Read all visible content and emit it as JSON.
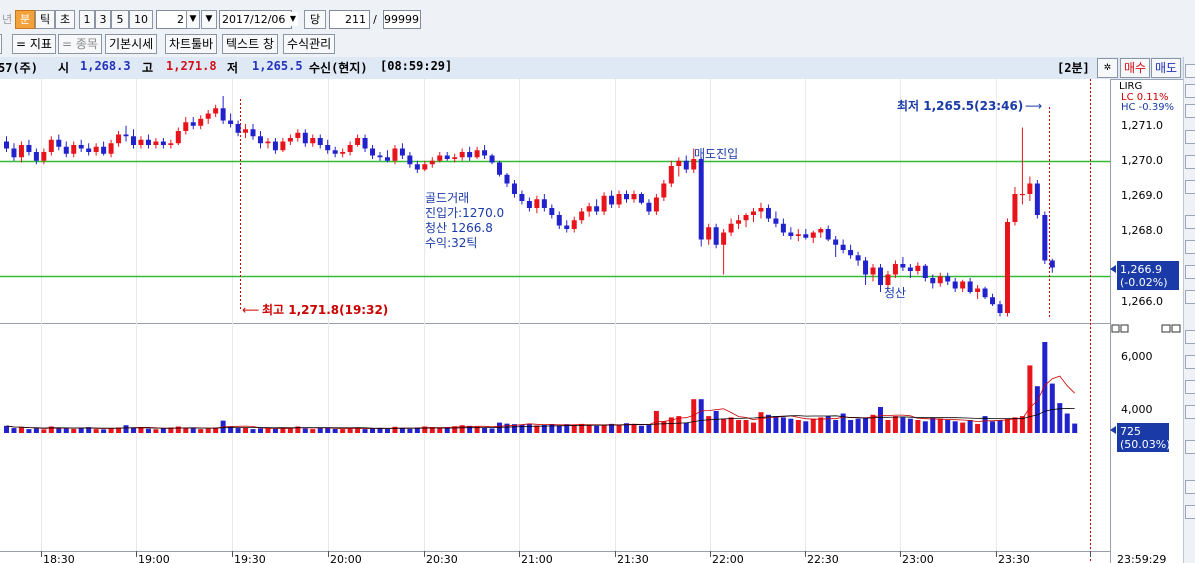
{
  "toolbar": {
    "period_tabs": [
      "년",
      "분",
      "틱",
      "초"
    ],
    "interval_buttons": [
      "1",
      "3",
      "5",
      "10"
    ],
    "interval_value": "2",
    "date_value": "2017/12/06",
    "dang_label": "당",
    "count_value": "211",
    "slash": "/",
    "max_value": "99999"
  },
  "toolbar2": {
    "buttons": [
      "= 지표",
      "= 종목",
      "기본시세",
      "차트툴바",
      "텍스트 창",
      "수식관리"
    ]
  },
  "info": {
    "code": "57(주)",
    "open_label": "시",
    "open_value": "1,268.3",
    "high_label": "고",
    "high_value": "1,271.8",
    "low_label": "저",
    "low_value": "1,265.5",
    "status": "수신(현지)",
    "time": "[08:59:29]",
    "period_badge": "[2분]",
    "settings_icon": "gear-icon",
    "buy_label": "매수",
    "sell_label": "매도"
  },
  "colors": {
    "up": "#e8141c",
    "down": "#2222cc",
    "hline": "#33bb33",
    "note": "#1a3aa8",
    "red_text": "#cc0000"
  },
  "annotations": {
    "lowest": "최저 1,265.5(23:46)",
    "highest": "최고 1,271.8(19:32)",
    "entry": "매도진입",
    "exit": "청산",
    "trade_lines": [
      "골드거래",
      "진입가:1270.0",
      "청산 1266.8",
      "수익:32틱"
    ]
  },
  "chart_data": {
    "type": "candlestick",
    "price_axis": {
      "ticks": [
        "1,271.0",
        "1,270.0",
        "1,269.0",
        "1,268.0",
        "1,266.0"
      ],
      "range": [
        1265.4,
        1271.8
      ]
    },
    "price_header": [
      "LIRG",
      "LC 0.11%",
      "HC -0.39%"
    ],
    "current_price": "1,266.9",
    "current_change": "(-0.02%)",
    "horizontal_lines": [
      1269.95,
      1266.65
    ],
    "volume_axis": {
      "ticks": [
        "6,000",
        "4,000"
      ],
      "range": [
        0,
        7500
      ]
    },
    "current_volume": "725",
    "current_volume_pct": "(50.03%)",
    "x_ticks": [
      "18:30",
      "19:00",
      "19:30",
      "20:00",
      "20:30",
      "21:00",
      "21:30",
      "22:00",
      "22:30",
      "23:00",
      "23:30",
      "23:59:29"
    ],
    "candles": [
      [
        1270.5,
        1270.65,
        1270.2,
        1270.3
      ],
      [
        1270.3,
        1270.45,
        1269.95,
        1270.05
      ],
      [
        1270.05,
        1270.5,
        1269.9,
        1270.4
      ],
      [
        1270.4,
        1270.55,
        1270.1,
        1270.2
      ],
      [
        1270.2,
        1270.3,
        1269.85,
        1269.95
      ],
      [
        1269.95,
        1270.3,
        1269.85,
        1270.2
      ],
      [
        1270.2,
        1270.65,
        1270.1,
        1270.55
      ],
      [
        1270.55,
        1270.7,
        1270.25,
        1270.35
      ],
      [
        1270.35,
        1270.5,
        1270.05,
        1270.15
      ],
      [
        1270.15,
        1270.5,
        1270.05,
        1270.4
      ],
      [
        1270.4,
        1270.55,
        1270.2,
        1270.3
      ],
      [
        1270.3,
        1270.45,
        1270.1,
        1270.2
      ],
      [
        1270.2,
        1270.45,
        1270.1,
        1270.35
      ],
      [
        1270.35,
        1270.5,
        1270.1,
        1270.15
      ],
      [
        1270.15,
        1270.55,
        1270.05,
        1270.45
      ],
      [
        1270.45,
        1270.8,
        1270.35,
        1270.7
      ],
      [
        1270.7,
        1270.95,
        1270.5,
        1270.65
      ],
      [
        1270.65,
        1270.85,
        1270.3,
        1270.4
      ],
      [
        1270.4,
        1270.65,
        1270.3,
        1270.55
      ],
      [
        1270.55,
        1270.7,
        1270.3,
        1270.4
      ],
      [
        1270.4,
        1270.6,
        1270.3,
        1270.5
      ],
      [
        1270.5,
        1270.6,
        1270.3,
        1270.4
      ],
      [
        1270.4,
        1270.55,
        1270.3,
        1270.45
      ],
      [
        1270.45,
        1270.9,
        1270.4,
        1270.8
      ],
      [
        1270.8,
        1271.2,
        1270.7,
        1271.05
      ],
      [
        1271.05,
        1271.2,
        1270.85,
        1270.95
      ],
      [
        1270.95,
        1271.25,
        1270.85,
        1271.15
      ],
      [
        1271.15,
        1271.4,
        1271.0,
        1271.3
      ],
      [
        1271.3,
        1271.55,
        1271.2,
        1271.45
      ],
      [
        1271.45,
        1271.8,
        1271.0,
        1271.1
      ],
      [
        1271.1,
        1271.3,
        1270.9,
        1271.0
      ],
      [
        1271.0,
        1271.1,
        1270.65,
        1270.75
      ],
      [
        1270.75,
        1271.0,
        1270.6,
        1270.85
      ],
      [
        1270.85,
        1271.0,
        1270.55,
        1270.65
      ],
      [
        1270.65,
        1270.8,
        1270.3,
        1270.45
      ],
      [
        1270.45,
        1270.6,
        1270.3,
        1270.5
      ],
      [
        1270.5,
        1270.6,
        1270.15,
        1270.25
      ],
      [
        1270.25,
        1270.6,
        1270.2,
        1270.5
      ],
      [
        1270.5,
        1270.7,
        1270.4,
        1270.6
      ],
      [
        1270.6,
        1270.85,
        1270.5,
        1270.75
      ],
      [
        1270.75,
        1270.85,
        1270.35,
        1270.45
      ],
      [
        1270.45,
        1270.7,
        1270.35,
        1270.6
      ],
      [
        1270.6,
        1270.7,
        1270.3,
        1270.4
      ],
      [
        1270.4,
        1270.55,
        1270.15,
        1270.25
      ],
      [
        1270.25,
        1270.35,
        1270.05,
        1270.15
      ],
      [
        1270.15,
        1270.3,
        1270.05,
        1270.2
      ],
      [
        1270.2,
        1270.5,
        1270.1,
        1270.4
      ],
      [
        1270.4,
        1270.7,
        1270.35,
        1270.6
      ],
      [
        1270.6,
        1270.7,
        1270.2,
        1270.3
      ],
      [
        1270.3,
        1270.4,
        1270.0,
        1270.1
      ],
      [
        1270.1,
        1270.2,
        1269.95,
        1270.05
      ],
      [
        1270.05,
        1270.25,
        1269.9,
        1269.95
      ],
      [
        1269.95,
        1270.4,
        1269.85,
        1270.3
      ],
      [
        1270.3,
        1270.45,
        1270.0,
        1270.1
      ],
      [
        1270.1,
        1270.2,
        1269.75,
        1269.85
      ],
      [
        1269.85,
        1269.95,
        1269.6,
        1269.7
      ],
      [
        1269.7,
        1269.95,
        1269.65,
        1269.85
      ],
      [
        1269.85,
        1270.05,
        1269.75,
        1269.95
      ],
      [
        1269.95,
        1270.2,
        1269.9,
        1270.1
      ],
      [
        1270.1,
        1270.2,
        1269.95,
        1270.0
      ],
      [
        1270.0,
        1270.15,
        1269.9,
        1270.05
      ],
      [
        1270.05,
        1270.3,
        1269.95,
        1270.2
      ],
      [
        1270.2,
        1270.35,
        1269.95,
        1270.05
      ],
      [
        1270.05,
        1270.35,
        1270.0,
        1270.25
      ],
      [
        1270.25,
        1270.4,
        1270.0,
        1270.1
      ],
      [
        1270.1,
        1270.15,
        1269.85,
        1269.9
      ],
      [
        1269.9,
        1269.95,
        1269.5,
        1269.55
      ],
      [
        1269.55,
        1269.6,
        1269.2,
        1269.3
      ],
      [
        1269.3,
        1269.4,
        1268.9,
        1269.0
      ],
      [
        1269.0,
        1269.1,
        1268.7,
        1268.8
      ],
      [
        1268.8,
        1268.9,
        1268.5,
        1268.6
      ],
      [
        1268.6,
        1268.95,
        1268.45,
        1268.85
      ],
      [
        1268.85,
        1269.0,
        1268.5,
        1268.6
      ],
      [
        1268.6,
        1268.7,
        1268.3,
        1268.4
      ],
      [
        1268.4,
        1268.5,
        1268.0,
        1268.1
      ],
      [
        1268.1,
        1268.25,
        1267.9,
        1268.0
      ],
      [
        1268.0,
        1268.35,
        1267.9,
        1268.25
      ],
      [
        1268.25,
        1268.6,
        1268.15,
        1268.5
      ],
      [
        1268.5,
        1268.75,
        1268.35,
        1268.65
      ],
      [
        1268.65,
        1268.85,
        1268.4,
        1268.5
      ],
      [
        1268.5,
        1269.05,
        1268.4,
        1268.95
      ],
      [
        1268.95,
        1269.1,
        1268.6,
        1268.7
      ],
      [
        1268.7,
        1269.1,
        1268.6,
        1269.0
      ],
      [
        1269.0,
        1269.1,
        1268.75,
        1268.85
      ],
      [
        1268.85,
        1269.1,
        1268.75,
        1269.0
      ],
      [
        1269.0,
        1269.05,
        1268.7,
        1268.75
      ],
      [
        1268.75,
        1268.85,
        1268.4,
        1268.5
      ],
      [
        1268.5,
        1269.0,
        1268.4,
        1268.9
      ],
      [
        1268.9,
        1269.4,
        1268.8,
        1269.3
      ],
      [
        1269.3,
        1269.95,
        1269.2,
        1269.8
      ],
      [
        1269.8,
        1270.05,
        1269.5,
        1269.95
      ],
      [
        1269.95,
        1270.1,
        1269.6,
        1269.7
      ],
      [
        1269.7,
        1270.3,
        1269.6,
        1270.0
      ],
      [
        1270.0,
        1270.05,
        1267.5,
        1267.7
      ],
      [
        1267.7,
        1268.15,
        1267.55,
        1268.05
      ],
      [
        1268.05,
        1268.15,
        1267.45,
        1267.55
      ],
      [
        1267.55,
        1268.0,
        1266.7,
        1267.9
      ],
      [
        1267.9,
        1268.3,
        1267.8,
        1268.15
      ],
      [
        1268.15,
        1268.4,
        1268.0,
        1268.25
      ],
      [
        1268.25,
        1268.45,
        1268.05,
        1268.4
      ],
      [
        1268.4,
        1268.6,
        1268.2,
        1268.5
      ],
      [
        1268.5,
        1268.75,
        1268.3,
        1268.6
      ],
      [
        1268.6,
        1268.7,
        1268.2,
        1268.3
      ],
      [
        1268.3,
        1268.5,
        1268.05,
        1268.15
      ],
      [
        1268.15,
        1268.3,
        1267.8,
        1267.9
      ],
      [
        1267.9,
        1268.05,
        1267.7,
        1267.8
      ],
      [
        1267.8,
        1268.0,
        1267.65,
        1267.85
      ],
      [
        1267.85,
        1268.0,
        1267.7,
        1267.75
      ],
      [
        1267.75,
        1267.95,
        1267.6,
        1267.9
      ],
      [
        1267.9,
        1268.05,
        1267.75,
        1268.0
      ],
      [
        1268.0,
        1268.1,
        1267.65,
        1267.7
      ],
      [
        1267.7,
        1267.8,
        1267.2,
        1267.55
      ],
      [
        1267.55,
        1267.7,
        1267.3,
        1267.4
      ],
      [
        1267.4,
        1267.55,
        1267.15,
        1267.25
      ],
      [
        1267.25,
        1267.35,
        1266.95,
        1267.1
      ],
      [
        1267.1,
        1267.2,
        1266.4,
        1266.7
      ],
      [
        1266.7,
        1267.0,
        1266.5,
        1266.9
      ],
      [
        1266.9,
        1267.0,
        1266.2,
        1266.4
      ],
      [
        1266.4,
        1266.8,
        1266.3,
        1266.7
      ],
      [
        1266.7,
        1267.1,
        1266.6,
        1267.0
      ],
      [
        1267.0,
        1267.2,
        1266.8,
        1266.9
      ],
      [
        1266.9,
        1267.0,
        1266.6,
        1266.8
      ],
      [
        1266.8,
        1267.05,
        1266.7,
        1266.95
      ],
      [
        1266.95,
        1267.0,
        1266.5,
        1266.6
      ],
      [
        1266.6,
        1266.7,
        1266.3,
        1266.45
      ],
      [
        1266.45,
        1266.75,
        1266.35,
        1266.65
      ],
      [
        1266.65,
        1266.75,
        1266.4,
        1266.5
      ],
      [
        1266.5,
        1266.6,
        1266.2,
        1266.3
      ],
      [
        1266.3,
        1266.55,
        1266.2,
        1266.5
      ],
      [
        1266.5,
        1266.6,
        1266.15,
        1266.2
      ],
      [
        1266.2,
        1266.4,
        1266.0,
        1266.3
      ],
      [
        1266.3,
        1266.35,
        1266.0,
        1266.05
      ],
      [
        1266.05,
        1266.15,
        1265.8,
        1265.85
      ],
      [
        1265.85,
        1265.95,
        1265.5,
        1265.6
      ],
      [
        1265.6,
        1268.3,
        1265.5,
        1268.2
      ],
      [
        1268.2,
        1269.2,
        1268.1,
        1269.0
      ],
      [
        1269.0,
        1270.9,
        1268.7,
        1269.0
      ],
      [
        1269.0,
        1269.5,
        1268.8,
        1269.3
      ],
      [
        1269.3,
        1269.4,
        1268.3,
        1268.4
      ],
      [
        1268.4,
        1268.5,
        1267.0,
        1267.1
      ],
      [
        1267.1,
        1267.15,
        1266.75,
        1266.9
      ]
    ],
    "volumes": [
      550,
      380,
      420,
      300,
      360,
      280,
      500,
      420,
      350,
      310,
      380,
      450,
      300,
      280,
      350,
      420,
      600,
      380,
      410,
      330,
      290,
      360,
      420,
      500,
      380,
      350,
      300,
      340,
      420,
      950,
      500,
      380,
      420,
      300,
      360,
      350,
      330,
      400,
      380,
      500,
      360,
      300,
      420,
      380,
      310,
      300,
      360,
      420,
      300,
      380,
      350,
      310,
      480,
      380,
      320,
      420,
      500,
      450,
      380,
      420,
      520,
      600,
      550,
      480,
      420,
      350,
      800,
      720,
      680,
      650,
      700,
      580,
      620,
      690,
      550,
      680,
      620,
      700,
      600,
      550,
      650,
      700,
      620,
      750,
      680,
      560,
      620,
      1700,
      900,
      1200,
      1300,
      800,
      2600,
      2600,
      1300,
      1700,
      1100,
      1200,
      1000,
      1000,
      800,
      1600,
      1400,
      1300,
      1200,
      1100,
      1000,
      900,
      1100,
      1200,
      1300,
      1000,
      1500,
      1000,
      1100,
      1200,
      1400,
      2000,
      1000,
      1300,
      1200,
      1100,
      1000,
      900,
      1200,
      1100,
      1000,
      900,
      800,
      1000,
      700,
      1300,
      900,
      1000,
      1100,
      1200,
      1300,
      5200,
      3600,
      7000,
      3800,
      2300,
      1500,
      725
    ]
  }
}
